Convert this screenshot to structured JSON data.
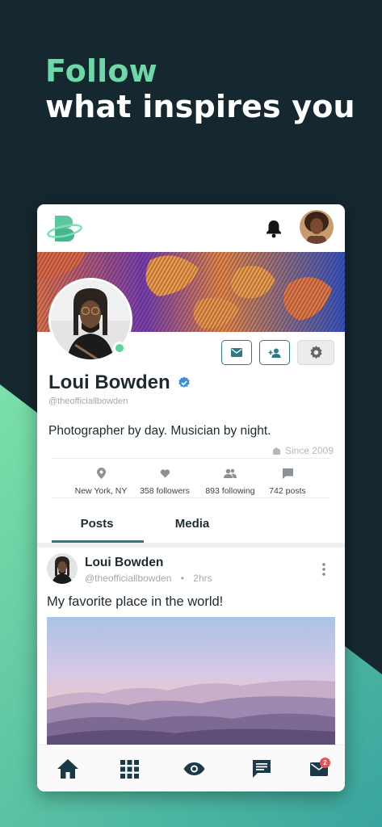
{
  "headline": {
    "line1": "Follow",
    "line2": "what inspires you"
  },
  "colors": {
    "background": "#15272f",
    "accent_green": "#6fd8a8",
    "teal": "#2f7a87",
    "online": "#5cd49b",
    "verified": "#3b8fd9",
    "badge": "#e05656"
  },
  "topbar": {
    "logo_icon": "brand-b-logo-icon",
    "notifications_icon": "bell-icon",
    "avatar": "user-avatar"
  },
  "profile": {
    "name": "Loui Bowden",
    "verified_icon": "verified-badge-icon",
    "handle": "@theofficiallbowden",
    "bio": "Photographer by day. Musician by night.",
    "since": "Since 2009",
    "actions": {
      "message_icon": "envelope-icon",
      "follow_icon": "add-person-icon",
      "settings_icon": "gear-icon"
    }
  },
  "stats": [
    {
      "icon": "location-pin-icon",
      "label": "New York, NY"
    },
    {
      "icon": "heart-icon",
      "label": "358 followers"
    },
    {
      "icon": "people-icon",
      "label": "893 following"
    },
    {
      "icon": "comment-icon",
      "label": "742 posts"
    }
  ],
  "tabs": [
    {
      "label": "Posts",
      "active": true
    },
    {
      "label": "Media",
      "active": false
    }
  ],
  "post": {
    "author": "Loui Bowden",
    "handle": "@theofficiallbowden",
    "separator": "•",
    "time": "2hrs",
    "text": "My favorite place in the world!",
    "menu_icon": "more-vertical-icon"
  },
  "bottom_nav": [
    {
      "icon": "home-icon"
    },
    {
      "icon": "grid-icon"
    },
    {
      "icon": "eye-icon"
    },
    {
      "icon": "chat-icon"
    },
    {
      "icon": "mail-icon",
      "badge": "2"
    }
  ]
}
